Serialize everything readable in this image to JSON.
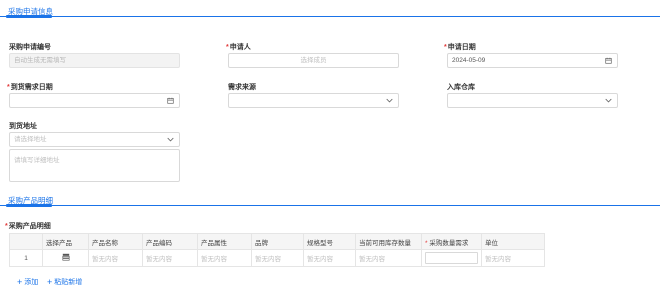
{
  "section1": {
    "title": "采购申请信息"
  },
  "form": {
    "request_no": {
      "label": "采购申请编号",
      "placeholder": "自动生成无需填写"
    },
    "applicant": {
      "label": "申请人",
      "placeholder": "选择成员"
    },
    "apply_date": {
      "label": "申请日期",
      "value": "2024-05-09"
    },
    "arrival_date": {
      "label": "到货需求日期",
      "value": ""
    },
    "demand_source": {
      "label": "需求来源",
      "value": ""
    },
    "warehouse": {
      "label": "入库仓库",
      "value": ""
    },
    "address": {
      "label": "到货地址",
      "region_placeholder": "请选择地址",
      "detail_placeholder": "请填写详细地址"
    }
  },
  "section2": {
    "title": "采购产品明细"
  },
  "product_table": {
    "label": "采购产品明细",
    "headers": [
      "",
      "选择产品",
      "产品名称",
      "产品编码",
      "产品属性",
      "品牌",
      "规格型号",
      "当前可用库存数量",
      "采购数量需求",
      "单位"
    ],
    "required_header": "采购数量需求",
    "rows": [
      {
        "index": "1",
        "name": "暂无内容",
        "code": "暂无内容",
        "attr": "暂无内容",
        "brand": "暂无内容",
        "spec": "暂无内容",
        "stock": "暂无内容",
        "unit": "暂无内容"
      }
    ]
  },
  "actions": {
    "add": "添加",
    "paste_add": "粘贴新增"
  },
  "colors": {
    "accent": "#1a73e8",
    "required": "#e23c3c",
    "border": "#d9d9d9"
  }
}
